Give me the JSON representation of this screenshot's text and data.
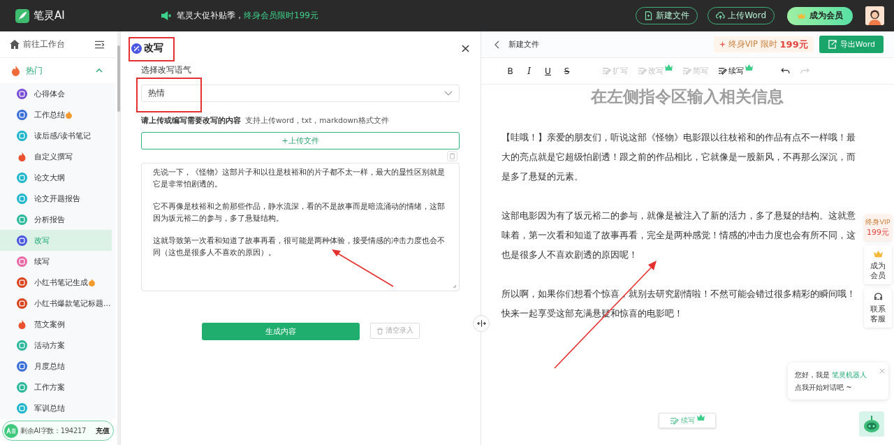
{
  "top_bar": {
    "brand": "笔灵AI",
    "promo": "笔灵大促补贴季，",
    "promo_highlight": "终身会员限时199元",
    "buttons": [
      {
        "label": "新建文件",
        "kind": "file"
      },
      {
        "label": "上传Word",
        "kind": "upload"
      }
    ],
    "member_button": "成为会员"
  },
  "sidebar": {
    "home": "前往工作台",
    "group": {
      "label": "热门",
      "expanded": true
    },
    "items": [
      {
        "label": "心得体会",
        "kind": "circle",
        "color": "#7a4fd8",
        "flame": false,
        "selected": false
      },
      {
        "label": "工作总结",
        "kind": "circle",
        "color": "#3a6fd8",
        "flame": true,
        "selected": false
      },
      {
        "label": "读后感/读书笔记",
        "kind": "circle",
        "color": "#20b6cc",
        "flame": false,
        "selected": false
      },
      {
        "label": "自定义撰写",
        "kind": "hot",
        "color": "#e8502e",
        "flame": false,
        "selected": false
      },
      {
        "label": "论文大纲",
        "kind": "circle",
        "color": "#20b6cc",
        "flame": false,
        "selected": false
      },
      {
        "label": "论文开题报告",
        "kind": "circle",
        "color": "#20b6cc",
        "flame": false,
        "selected": false
      },
      {
        "label": "分析报告",
        "kind": "circle",
        "color": "#2bb89c",
        "flame": false,
        "selected": false
      },
      {
        "label": "改写",
        "kind": "circle",
        "color": "#4a57e0",
        "flame": false,
        "selected": true
      },
      {
        "label": "续写",
        "kind": "circle",
        "color": "#ea6aa8",
        "flame": false,
        "selected": false
      },
      {
        "label": "小红书笔记生成",
        "kind": "circle",
        "color": "#d9431e",
        "flame": true,
        "selected": false
      },
      {
        "label": "小红书爆款笔记标题...",
        "kind": "circle",
        "color": "#d9431e",
        "flame": false,
        "selected": false
      },
      {
        "label": "范文案例",
        "kind": "hot",
        "color": "#e8502e",
        "flame": false,
        "selected": false
      },
      {
        "label": "活动方案",
        "kind": "circle",
        "color": "#2bb89c",
        "flame": false,
        "selected": false
      },
      {
        "label": "月度总结",
        "kind": "circle",
        "color": "#3a6fd8",
        "flame": false,
        "selected": false
      },
      {
        "label": "工作方案",
        "kind": "circle",
        "color": "#2bb89c",
        "flame": false,
        "selected": false
      },
      {
        "label": "军训总结",
        "kind": "circle",
        "color": "#20b6cc",
        "flame": false,
        "selected": false
      }
    ],
    "quota": {
      "label": "剩余AI字数：194217",
      "action": "充值"
    }
  },
  "form": {
    "title": "改写",
    "tone_label": "选择改写语气",
    "tone_value": "热情",
    "content_label": "请上传或编写需要改写的内容",
    "content_hint": "支持上传word，txt，markdown格式文件",
    "upload_button": "+上传文件",
    "content": [
      "先说一下，《怪物》这部片子和以往是枝裕和的片子都不太一样，最大的显性区别就是它是非常怕剧透的。",
      "它不再像是枝裕和之前那些作品，静水流深，看的不是故事而是暗流涌动的情绪，这部因为坂元裕二的参与，多了悬疑结构。",
      "这就导致第一次看和知道了故事再看，很可能是两种体验，接受情感的冲击力度也会不同（这也是很多人不喜欢的原因）。"
    ],
    "generate_button": "生成内容",
    "clear_button": "清空录入"
  },
  "editor": {
    "file_name": "新建文件",
    "vip_promo": "终身VIP 限时",
    "vip_price": "199元",
    "export_button": "导出Word",
    "format_tools": [
      "B",
      "I",
      "U",
      "S"
    ],
    "ai_tools": [
      {
        "label": "扩写",
        "disabled": true,
        "crown": false
      },
      {
        "label": "改写",
        "disabled": true,
        "crown": true
      },
      {
        "label": "简写",
        "disabled": true,
        "crown": false
      },
      {
        "label": "续写",
        "disabled": false,
        "crown": true
      }
    ],
    "redo_disabled": true,
    "placeholder_heading": "在左侧指令区输入相关信息",
    "paragraphs": [
      "【哇哦！】亲爱的朋友们，听说这部《怪物》电影跟以往枝裕和的作品有点不一样哦！最大的亮点就是它超级怕剧透！跟之前的作品相比，它就像是一股新风，不再那么深沉，而是多了悬疑的元素。",
      "这部电影因为有了坂元裕二的参与，就像是被注入了新的活力，多了悬疑的结构。这就意味着，第一次看和知道了故事再看，完全是两种感觉！情感的冲击力度也会有所不同，这也是很多人不喜欢剧透的原因呢！",
      "所以啊，如果你们想看个惊喜，就别去研究剧情啦！不然可能会错过很多精彩的瞬间哦！快来一起享受这部充满悬疑和惊喜的电影吧！"
    ],
    "continue_button": "续写"
  },
  "side_float": {
    "vip_label": "终身VIP",
    "vip_price": "199元",
    "member_label": "成为会员",
    "service_label": "联系客服"
  },
  "chat_bubble": {
    "greeting": "您好，我是",
    "bot_name": "笔灵机器人",
    "prompt": "点我开始对话吧 ~"
  }
}
